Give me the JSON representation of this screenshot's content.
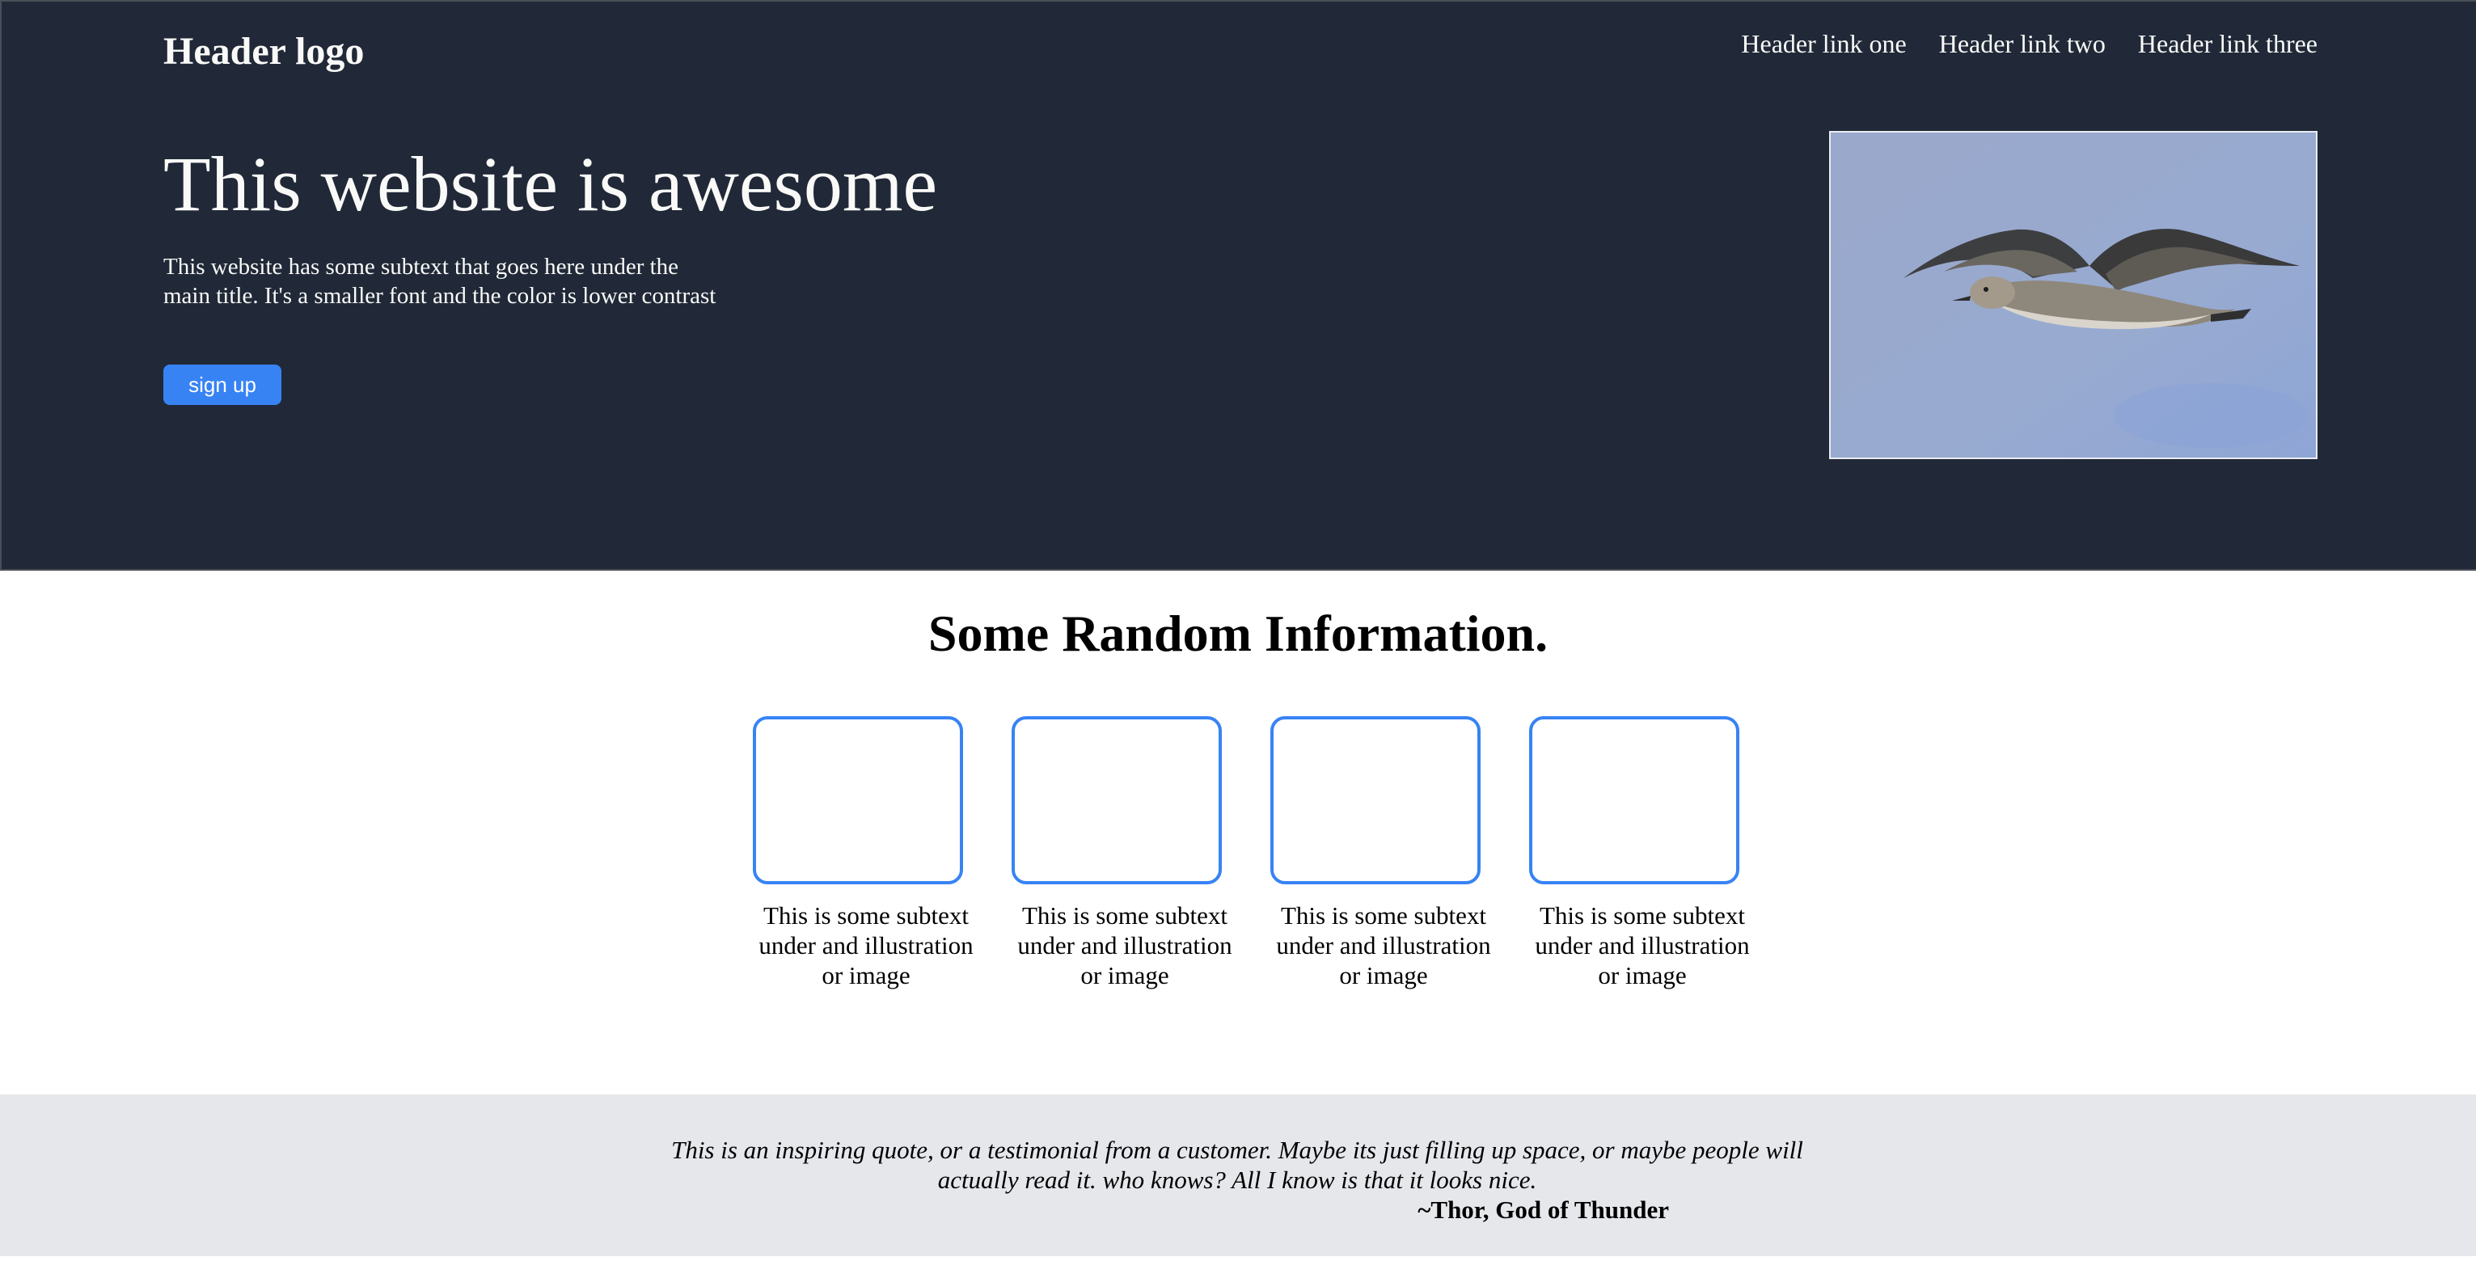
{
  "header": {
    "logo": "Header logo",
    "nav_links": [
      "Header link one",
      "Header link two",
      "Header link three"
    ]
  },
  "hero": {
    "title": "This website is awesome",
    "subtext": "This website has some subtext that goes here under the main title. It's a smaller font and the color is lower contrast",
    "button_label": "sign up",
    "image_description": "seagull-in-flight"
  },
  "info": {
    "title": "Some Random Information.",
    "cards": [
      {
        "text": "This is some subtext under and illustration or image"
      },
      {
        "text": "This is some subtext under and illustration or image"
      },
      {
        "text": "This is some subtext under and illustration or image"
      },
      {
        "text": "This is some subtext under and illustration or image"
      }
    ]
  },
  "quote": {
    "text": "This is an inspiring quote, or a testimonial from a customer. Maybe its just filling up space, or maybe people will actually read it. who knows? All I know is that it looks nice.",
    "author": "~Thor, God of Thunder"
  },
  "colors": {
    "hero_background": "#212938",
    "text_light": "#f9faf8",
    "accent_blue": "#3883f4",
    "quote_background": "#e5e7eb"
  }
}
